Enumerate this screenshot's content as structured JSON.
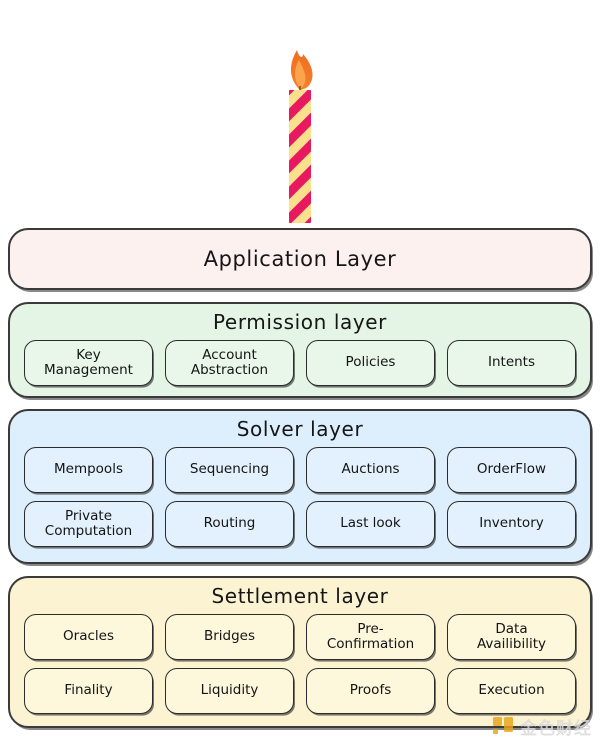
{
  "background_color": "#ffffff",
  "illustration": {
    "name": "birthday-candle",
    "flame_color": "#f47b20",
    "flame_inner_color": "#fca44b",
    "candle_colors": [
      "#e8195f",
      "#fa8fb4",
      "#f9e08a"
    ]
  },
  "layers": [
    {
      "id": "application",
      "title": "Application Layer",
      "panel_color": "#fdf1f0",
      "cell_color": "#fdf7f6",
      "rows": []
    },
    {
      "id": "permission",
      "title": "Permission layer",
      "panel_color": "#e4f5e5",
      "cell_color": "#e9f7ea",
      "rows": [
        [
          {
            "line1": "Key",
            "line2": "Management"
          },
          {
            "line1": "Account",
            "line2": "Abstraction"
          },
          {
            "line1": "Policies",
            "line2": ""
          },
          {
            "line1": "Intents",
            "line2": ""
          }
        ]
      ]
    },
    {
      "id": "solver",
      "title": "Solver layer",
      "panel_color": "#ddeefc",
      "cell_color": "#e2f1fd",
      "rows": [
        [
          {
            "line1": "Mempools",
            "line2": ""
          },
          {
            "line1": "Sequencing",
            "line2": ""
          },
          {
            "line1": "Auctions",
            "line2": ""
          },
          {
            "line1": "OrderFlow",
            "line2": ""
          }
        ],
        [
          {
            "line1": "Private",
            "line2": "Computation"
          },
          {
            "line1": "Routing",
            "line2": ""
          },
          {
            "line1": "Last look",
            "line2": ""
          },
          {
            "line1": "Inventory",
            "line2": ""
          }
        ]
      ]
    },
    {
      "id": "settlement",
      "title": "Settlement layer",
      "panel_color": "#fbf3d2",
      "cell_color": "#fdf7dc",
      "rows": [
        [
          {
            "line1": "Oracles",
            "line2": ""
          },
          {
            "line1": "Bridges",
            "line2": ""
          },
          {
            "line1": "Pre-",
            "line2": "Confirmation"
          },
          {
            "line1": "Data",
            "line2": "Availibility"
          }
        ],
        [
          {
            "line1": "Finality",
            "line2": ""
          },
          {
            "line1": "Liquidity",
            "line2": ""
          },
          {
            "line1": "Proofs",
            "line2": ""
          },
          {
            "line1": "Execution",
            "line2": ""
          }
        ]
      ]
    }
  ],
  "watermark": {
    "text": "金色财经",
    "logo_color": "#e8a317",
    "logo_name": "jinse-finance-logo"
  }
}
